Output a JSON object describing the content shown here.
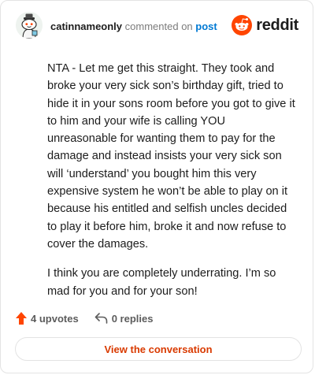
{
  "header": {
    "username": "catinnameonly",
    "commented_on": "commented on",
    "post_link": "post",
    "brand_name": "reddit",
    "brand_color": "#ff4500",
    "avatar_icon": "snoo-avatar-icon"
  },
  "comment": {
    "paragraphs": [
      "NTA - Let me get this straight. They took and broke your very sick son’s birthday gift, tried to hide it in your sons room before you got to give it to him and your wife is calling YOU unreasonable for wanting them to pay for the damage and instead insists your very sick son will ‘understand’ you bought him this very expensive system he won’t be able to play on it because his entitled and selfish uncles decided to play it before him, broke it and now refuse to cover the damages.",
      "I think you are completely underrating. I’m so mad for you and for your son!"
    ]
  },
  "actions": {
    "upvotes_label": "4 upvotes",
    "upvote_icon": "upvote-arrow-icon",
    "upvote_color": "#ff4500",
    "replies_label": "0 replies",
    "reply_icon": "reply-arrow-icon"
  },
  "footer": {
    "view_conversation_label": "View the conversation",
    "accent_color": "#d93a00"
  }
}
